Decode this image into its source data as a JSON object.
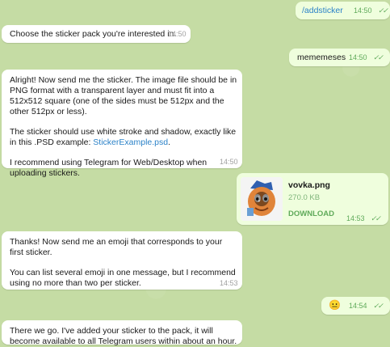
{
  "messages": [
    {
      "id": "m1",
      "dir": "out",
      "text": "/addsticker",
      "time": "14:50"
    },
    {
      "id": "m2",
      "dir": "in",
      "text": "Choose the sticker pack you're interested in.",
      "time": "14:50"
    },
    {
      "id": "m3",
      "dir": "out",
      "text": "mememeses",
      "time": "14:50"
    },
    {
      "id": "m4",
      "dir": "in",
      "p1": "Alright! Now send me the sticker. The image file should be in PNG format with a transparent layer and must fit into a 512x512 square (one of the sides must be 512px and the other 512px or less).",
      "p2_pre": "The sticker should use white stroke and shadow, exactly like in this .PSD example: ",
      "p2_link": "StickerExample.psd",
      "p2_post": ".",
      "p3": "I recommend using Telegram for Web/Desktop when uploading stickers.",
      "time": "14:50"
    },
    {
      "id": "m5",
      "dir": "out",
      "file_name": "vovka.png",
      "file_size": "270.0 KB",
      "action": "DOWNLOAD",
      "time": "14:53"
    },
    {
      "id": "m6",
      "dir": "in",
      "p1": "Thanks! Now send me an emoji that corresponds to your first sticker.",
      "p2": "You can list several emoji in one message, but I recommend using no more than two per sticker.",
      "time": "14:53"
    },
    {
      "id": "m7",
      "dir": "out",
      "emoji": "😐",
      "time": "14:54"
    },
    {
      "id": "m8",
      "dir": "in",
      "text": "There we go. I've added your sticker to the pack, it will become available to all Telegram users within about an hour."
    }
  ],
  "colors": {
    "background": "#c5dca4",
    "incoming": "#ffffff",
    "outgoing": "#effedd",
    "link": "#2b82c8",
    "check": "#5faa5a"
  },
  "icons": {
    "read_receipt": "double-check-icon",
    "download": "download-arrow-icon"
  }
}
